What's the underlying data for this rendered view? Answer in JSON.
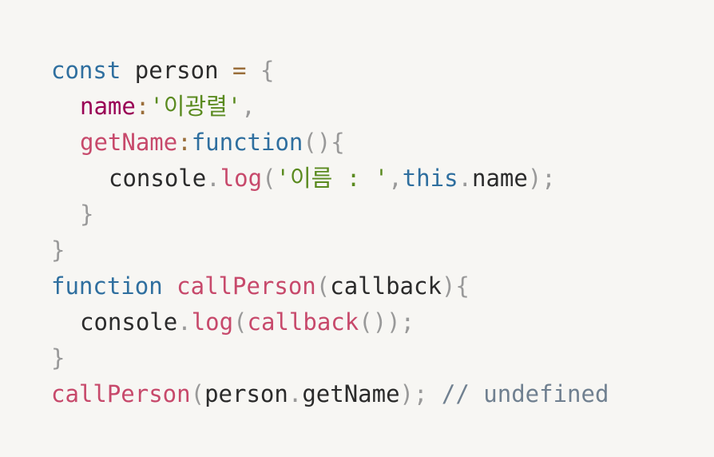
{
  "code": {
    "line1": {
      "kw": "const",
      "var": "person",
      "op": "=",
      "brace": "{"
    },
    "line2": {
      "prop": "name",
      "colon": ":",
      "str": "'이광렬'",
      "comma": ","
    },
    "line3": {
      "prop": "getName",
      "colon": ":",
      "kw": "function",
      "parens": "(){"
    },
    "line4": {
      "obj": "console",
      "dot": ".",
      "fn": "log",
      "open": "(",
      "str": "'이름 : '",
      "comma": ",",
      "kw": "this",
      "dot2": ".",
      "prop": "name",
      "close": ");"
    },
    "line5": {
      "brace": "}"
    },
    "line6": {
      "brace": "}"
    },
    "line7": {
      "kw": "function",
      "fn": "callPerson",
      "open": "(",
      "param": "callback",
      "close": "){"
    },
    "line8": {
      "obj": "console",
      "dot": ".",
      "fn": "log",
      "open": "(",
      "arg": "callback",
      "close": "());"
    },
    "line9": {
      "brace": "}"
    },
    "line10": {
      "fn": "callPerson",
      "open": "(",
      "obj": "person",
      "dot": ".",
      "prop": "getName",
      "close": ");",
      "comment": "// undefined"
    }
  }
}
